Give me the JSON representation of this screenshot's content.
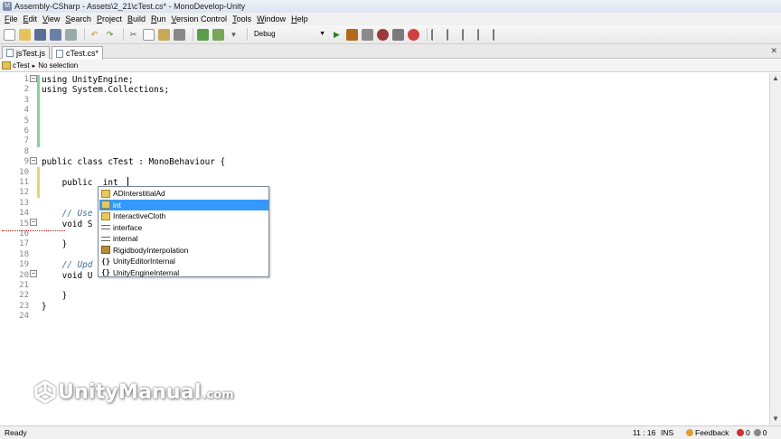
{
  "window": {
    "title": "Assembly-CSharp - Assets\\2_21\\cTest.cs* - MonoDevelop-Unity"
  },
  "menu": [
    {
      "label": "File",
      "key": "F",
      "rest": "ile"
    },
    {
      "label": "Edit",
      "key": "E",
      "rest": "dit"
    },
    {
      "label": "View",
      "key": "V",
      "rest": "iew"
    },
    {
      "label": "Search",
      "key": "S",
      "rest": "earch"
    },
    {
      "label": "Project",
      "key": "P",
      "rest": "roject"
    },
    {
      "label": "Build",
      "key": "B",
      "rest": "uild"
    },
    {
      "label": "Run",
      "key": "R",
      "rest": "un"
    },
    {
      "label": "Version Control",
      "key": "V",
      "rest": "ersion Control"
    },
    {
      "label": "Tools",
      "key": "T",
      "rest": "ools"
    },
    {
      "label": "Window",
      "key": "W",
      "rest": "indow"
    },
    {
      "label": "Help",
      "key": "H",
      "rest": "elp"
    }
  ],
  "toolbar": {
    "configuration": "Debug"
  },
  "tabs": [
    {
      "label": "jsTest.js",
      "active": false
    },
    {
      "label": "cTest.cs*",
      "active": true
    }
  ],
  "pathbar": {
    "class_name": "cTest",
    "member": "No selection"
  },
  "editor": {
    "line_numbers": [
      "1",
      "2",
      "3",
      "4",
      "5",
      "6",
      "7",
      "8",
      "9",
      "10",
      "11",
      "12",
      "13",
      "14",
      "15",
      "16",
      "17",
      "18",
      "19",
      "20",
      "21",
      "22",
      "23",
      "24"
    ],
    "lines": [
      {
        "code": "using UnityEngine;",
        "comment": ""
      },
      {
        "code": "using System.Collections;",
        "comment": ""
      },
      {
        "code": "",
        "comment": ""
      },
      {
        "code": "",
        "comment": ""
      },
      {
        "code": "",
        "comment": ""
      },
      {
        "code": "",
        "comment": ""
      },
      {
        "code": "",
        "comment": ""
      },
      {
        "code": "",
        "comment": ""
      },
      {
        "code": "public class cTest : MonoBehaviour {",
        "comment": ""
      },
      {
        "code": "",
        "comment": ""
      },
      {
        "code": "    public  int",
        "comment": ""
      },
      {
        "code": "",
        "comment": ""
      },
      {
        "code": "",
        "comment": ""
      },
      {
        "code": "    ",
        "comment": "// Use"
      },
      {
        "code": "    void S",
        "comment": ""
      },
      {
        "code": "",
        "comment": ""
      },
      {
        "code": "    }",
        "comment": ""
      },
      {
        "code": "",
        "comment": ""
      },
      {
        "code": "    ",
        "comment": "// Upd"
      },
      {
        "code": "    void U",
        "comment": ""
      },
      {
        "code": "",
        "comment": ""
      },
      {
        "code": "    }",
        "comment": ""
      },
      {
        "code": "}",
        "comment": ""
      },
      {
        "code": "",
        "comment": ""
      }
    ]
  },
  "completion": {
    "items": [
      {
        "label": "ADInterstitialAd",
        "icon": "class-icon",
        "selected": false
      },
      {
        "label": "int",
        "icon": "struct-icon",
        "selected": true
      },
      {
        "label": "InteractiveCloth",
        "icon": "class-icon",
        "selected": false
      },
      {
        "label": "interface",
        "icon": "keyword-icon",
        "selected": false
      },
      {
        "label": "internal",
        "icon": "keyword-icon",
        "selected": false
      },
      {
        "label": "RigidbodyInterpolation",
        "icon": "enum-icon",
        "selected": false
      },
      {
        "label": "UnityEditorInternal",
        "icon": "namespace-icon",
        "selected": false
      },
      {
        "label": "UnityEngineInternal",
        "icon": "namespace-icon",
        "selected": false
      }
    ]
  },
  "watermark": {
    "brand": "UnityManual",
    "domain": ".com"
  },
  "status": {
    "ready": "Ready",
    "position": "11 : 16",
    "mode": "INS",
    "feedback": "Feedback",
    "errors": "0",
    "warnings": "0"
  },
  "colors": {
    "selection": "#3399ff",
    "change_marker": "#8bd18f",
    "comment": "#3f6fa5"
  }
}
